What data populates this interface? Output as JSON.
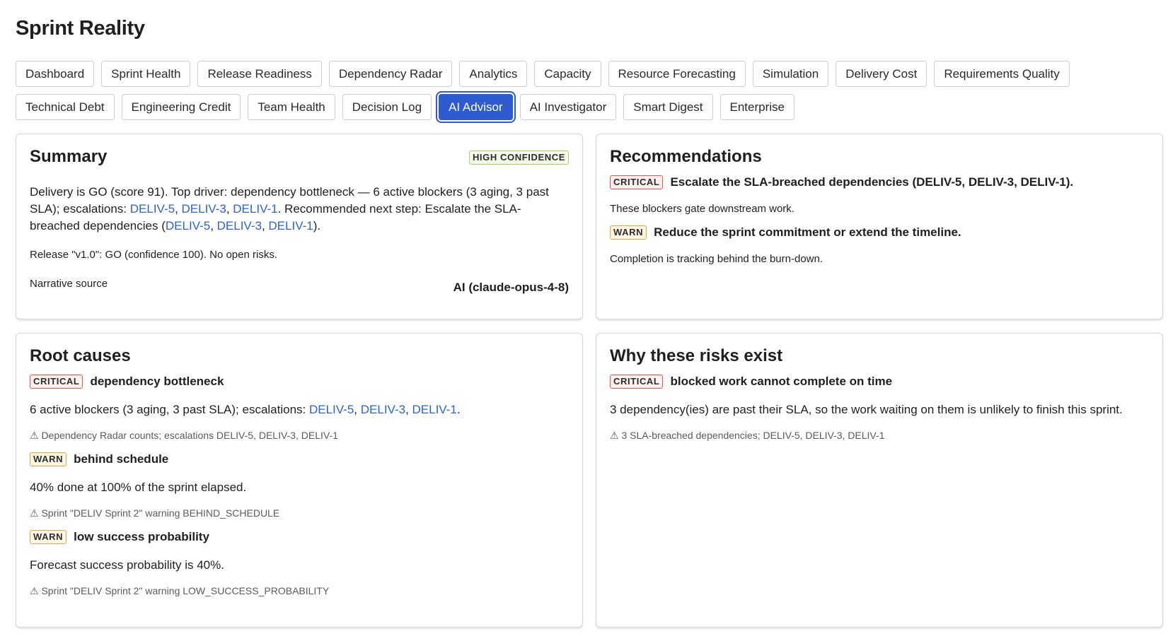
{
  "app": {
    "title": "Sprint Reality"
  },
  "tabs": [
    [
      "Dashboard",
      "Sprint Health",
      "Release Readiness",
      "Dependency Radar",
      "Analytics",
      "Capacity",
      "Resource Forecasting",
      "Simulation",
      "Delivery Cost",
      "Requirements Quality"
    ],
    [
      "Technical Debt",
      "Engineering Credit",
      "Team Health",
      "Decision Log",
      "AI Advisor",
      "AI Investigator",
      "Smart Digest",
      "Enterprise"
    ]
  ],
  "active_tab": "AI Advisor",
  "summary": {
    "title": "Summary",
    "confidence_badge": "HIGH CONFIDENCE",
    "text_parts": {
      "p1": "Delivery is GO (score 91). Top driver: dependency bottleneck — 6 active blockers (3 aging, 3 past SLA); escalations: ",
      "link1": "DELIV-5",
      "sep1": ", ",
      "link2": "DELIV-3",
      "sep2": ", ",
      "link3": "DELIV-1",
      "p2": ". Recommended next step: Escalate the SLA-breached dependencies (",
      "link4": "DELIV-5",
      "sep3": ", ",
      "link5": "DELIV-3",
      "sep4": ", ",
      "link6": "DELIV-1",
      "p3": ")."
    },
    "release_text": "Release \"v1.0\": GO (confidence 100). No open risks.",
    "source_label": "Narrative source",
    "source_value": "AI (claude-opus-4-8)"
  },
  "recommendations": {
    "title": "Recommendations",
    "items": [
      {
        "severity": "CRITICAL",
        "title": "Escalate the SLA-breached dependencies (DELIV-5, DELIV-3, DELIV-1).",
        "detail": "These blockers gate downstream work."
      },
      {
        "severity": "WARN",
        "title": "Reduce the sprint commitment or extend the timeline.",
        "detail": "Completion is tracking behind the burn-down."
      }
    ]
  },
  "root_causes": {
    "title": "Root causes",
    "items": [
      {
        "severity": "CRITICAL",
        "title": "dependency bottleneck",
        "desc_prefix": "6 active blockers (3 aging, 3 past SLA); escalations: ",
        "links": [
          "DELIV-5",
          "DELIV-3",
          "DELIV-1"
        ],
        "sep": ", ",
        "desc_suffix": ".",
        "evidence": "⚠ Dependency Radar counts; escalations DELIV-5, DELIV-3, DELIV-1"
      },
      {
        "severity": "WARN",
        "title": "behind schedule",
        "desc": "40% done at 100% of the sprint elapsed.",
        "evidence": "⚠ Sprint \"DELIV Sprint 2\" warning BEHIND_SCHEDULE"
      },
      {
        "severity": "WARN",
        "title": "low success probability",
        "desc": "Forecast success probability is 40%.",
        "evidence": "⚠ Sprint \"DELIV Sprint 2\" warning LOW_SUCCESS_PROBABILITY"
      }
    ]
  },
  "why_risks": {
    "title": "Why these risks exist",
    "items": [
      {
        "severity": "CRITICAL",
        "title": "blocked work cannot complete on time",
        "desc": "3 dependency(ies) are past their SLA, so the work waiting on them is unlikely to finish this sprint.",
        "evidence": "⚠ 3 SLA-breached dependencies; DELIV-5, DELIV-3, DELIV-1"
      }
    ]
  },
  "colors": {
    "accent": "#2f5bd1",
    "link": "#2c62d6",
    "critical": "#e5544d",
    "warn": "#f0a23b",
    "high_confidence": "#a6cf6b"
  }
}
